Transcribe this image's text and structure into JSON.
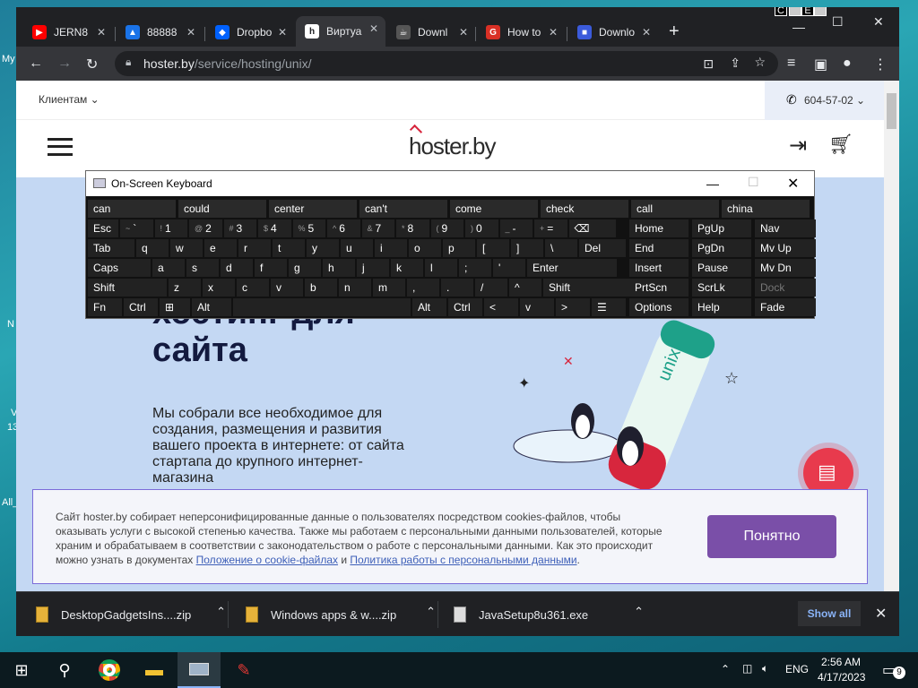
{
  "desktop": {
    "labels": [
      "My",
      "N",
      "All_",
      "V",
      "13"
    ]
  },
  "browser": {
    "tabs": [
      {
        "label": "JERN8",
        "fav": "YT",
        "color": "#ff0000"
      },
      {
        "label": "88888",
        "fav": "▲",
        "color": "#1a73e8"
      },
      {
        "label": "Dropbo",
        "fav": "◆",
        "color": "#0061fe"
      },
      {
        "label": "Виртуа",
        "fav": "h",
        "color": "#ffffff"
      },
      {
        "label": "Downl",
        "fav": "☕",
        "color": "#aaaaaa"
      },
      {
        "label": "How to",
        "fav": "G",
        "color": "#d93025"
      },
      {
        "label": "Downlo",
        "fav": "■",
        "color": "#3b5bdb"
      }
    ],
    "ce": [
      "C",
      "E"
    ],
    "url_host": "hoster.by",
    "url_path": "/service/hosting/unix/"
  },
  "site": {
    "clients": "Клиентам ⌄",
    "phone": "604-57-02 ⌄",
    "logo": "hoster.by",
    "hero_title_1": "хостинг для",
    "hero_title_2": "сайта",
    "hero_text": "Мы собрали все необходимое для создания, размещения и развития вашего проекта в интернете: от сайта стартапа до крупного интернет-магазина",
    "tube": "unix",
    "cookie_text_1": "Сайт hoster.by собирает неперсонифицированные данные о пользователях посредством cookies-файлов, чтобы оказывать услуги с высокой степенью качества. Также мы работаем с персональными данными пользователей, которые храним и обрабатываем в соответствии с законодательством о работе с персональными данными. Как это происходит можно узнать в документах ",
    "cookie_link_1": "Положение о cookie-файлах",
    "cookie_and": " и ",
    "cookie_link_2": "Политика работы с персональными данными",
    "cookie_end": ".",
    "cookie_btn": "Понятно"
  },
  "osk": {
    "title": "On-Screen Keyboard",
    "predictions": [
      "can",
      "could",
      "center",
      "can't",
      "come",
      "check",
      "call",
      "china"
    ],
    "row1": [
      [
        "Esc",
        ""
      ],
      [
        "`",
        "~"
      ],
      [
        "1",
        "!"
      ],
      [
        "2",
        "@"
      ],
      [
        "3",
        "#"
      ],
      [
        "4",
        "$"
      ],
      [
        "5",
        "%"
      ],
      [
        "6",
        "^"
      ],
      [
        "7",
        "&"
      ],
      [
        "8",
        "*"
      ],
      [
        "9",
        "("
      ],
      [
        "0",
        ")"
      ],
      [
        "-",
        "_"
      ],
      [
        "=",
        "+"
      ],
      [
        "⌫",
        ""
      ]
    ],
    "row2": [
      "Tab",
      "q",
      "w",
      "e",
      "r",
      "t",
      "y",
      "u",
      "i",
      "o",
      "p",
      "[",
      "]",
      "\\",
      "Del"
    ],
    "row3": [
      "Caps",
      "a",
      "s",
      "d",
      "f",
      "g",
      "h",
      "j",
      "k",
      "l",
      ";",
      "'",
      "Enter"
    ],
    "row4": [
      "Shift",
      "z",
      "x",
      "c",
      "v",
      "b",
      "n",
      "m",
      ",",
      ".",
      "/",
      "^",
      "Shift"
    ],
    "row5": [
      "Fn",
      "Ctrl",
      "⊞",
      "Alt",
      "",
      "Alt",
      "Ctrl",
      "<",
      "v",
      ">",
      "☰"
    ],
    "side": [
      [
        "Home",
        "PgUp",
        "Nav"
      ],
      [
        "End",
        "PgDn",
        "Mv Up"
      ],
      [
        "Insert",
        "Pause",
        "Mv Dn"
      ],
      [
        "PrtScn",
        "ScrLk",
        "Dock"
      ],
      [
        "Options",
        "Help",
        "Fade"
      ]
    ]
  },
  "downloads": {
    "items": [
      "DesktopGadgetsIns....zip",
      "Windows apps & w....zip",
      "JavaSetup8u361.exe"
    ],
    "show_all": "Show all"
  },
  "taskbar": {
    "lang": "ENG",
    "time": "2:56 AM",
    "date": "4/17/2023",
    "notif": "9"
  }
}
